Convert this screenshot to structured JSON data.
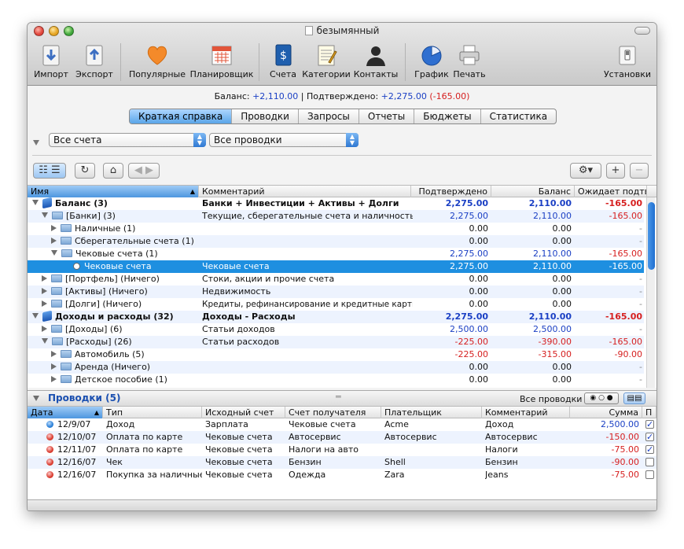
{
  "window": {
    "title": "безымянный"
  },
  "toolbar": {
    "import": "Импорт",
    "export": "Экспорт",
    "popular": "Популярные",
    "planner": "Планировщик",
    "accounts": "Счета",
    "categories": "Категории",
    "contacts": "Контакты",
    "graph": "График",
    "print": "Печать",
    "settings": "Установки"
  },
  "summary": {
    "balance_label": "Баланс:",
    "balance": "+2,110.00",
    "sep": "|",
    "confirmed_label": "Подтверждено:",
    "confirmed": "+2,275.00",
    "diff": "(-165.00)"
  },
  "tabs": [
    "Краткая справка",
    "Проводки",
    "Запросы",
    "Отчеты",
    "Бюджеты",
    "Статистика"
  ],
  "filters": {
    "accounts": "Все счета",
    "transactions": "Все проводки"
  },
  "accounts_table": {
    "headers": {
      "name": "Имя",
      "comment": "Комментарий",
      "confirmed": "Подтверждено",
      "balance": "Баланс",
      "pending": "Ожидает подтв..."
    },
    "rows": [
      {
        "name": "Баланс (3)",
        "comment": "Банки + Инвестиции + Активы + Долги",
        "confirmed": "2,275.00",
        "balance": "2,110.00",
        "pending": "-165.00"
      },
      {
        "name": "[Банки] (3)",
        "comment": "Текущие, сберегательные счета и наличность",
        "confirmed": "2,275.00",
        "balance": "2,110.00",
        "pending": "-165.00"
      },
      {
        "name": "Наличные (1)",
        "comment": "",
        "confirmed": "0.00",
        "balance": "0.00",
        "pending": "-"
      },
      {
        "name": "Сберегательные счета (1)",
        "comment": "",
        "confirmed": "0.00",
        "balance": "0.00",
        "pending": "-"
      },
      {
        "name": "Чековые счета (1)",
        "comment": "",
        "confirmed": "2,275.00",
        "balance": "2,110.00",
        "pending": "-165.00"
      },
      {
        "name": "Чековые счета",
        "comment": "Чековые счета",
        "confirmed": "2,275.00",
        "balance": "2,110.00",
        "pending": "-165.00"
      },
      {
        "name": "[Портфель] (Ничего)",
        "comment": "Стоки, акции и прочие счета",
        "confirmed": "0.00",
        "balance": "0.00",
        "pending": "-"
      },
      {
        "name": "[Активы] (Ничего)",
        "comment": "Недвижимость",
        "confirmed": "0.00",
        "balance": "0.00",
        "pending": "-"
      },
      {
        "name": "[Долги] (Ничего)",
        "comment": "Кредиты, рефинансирование и кредитные карты",
        "confirmed": "0.00",
        "balance": "0.00",
        "pending": "-"
      },
      {
        "name": "Доходы и расходы (32)",
        "comment": "Доходы - Расходы",
        "confirmed": "2,275.00",
        "balance": "2,110.00",
        "pending": "-165.00"
      },
      {
        "name": "[Доходы] (6)",
        "comment": "Статьи доходов",
        "confirmed": "2,500.00",
        "balance": "2,500.00",
        "pending": "-"
      },
      {
        "name": "[Расходы] (26)",
        "comment": "Статьи расходов",
        "confirmed": "-225.00",
        "balance": "-390.00",
        "pending": "-165.00"
      },
      {
        "name": "Автомобиль (5)",
        "comment": "",
        "confirmed": "-225.00",
        "balance": "-315.00",
        "pending": "-90.00"
      },
      {
        "name": "Аренда (Ничего)",
        "comment": "",
        "confirmed": "0.00",
        "balance": "0.00",
        "pending": "-"
      },
      {
        "name": "Детское пособие (1)",
        "comment": "",
        "confirmed": "0.00",
        "balance": "0.00",
        "pending": "-"
      }
    ]
  },
  "transactions": {
    "title": "Проводки (5)",
    "filter_label": "Все проводки",
    "headers": {
      "date": "Дата",
      "type": "Тип",
      "from": "Исходный счет",
      "to": "Счет получателя",
      "payee": "Плательщик",
      "comment": "Комментарий",
      "amount": "Сумма",
      "flag": "П"
    },
    "rows": [
      {
        "date": "12/9/07",
        "type": "Доход",
        "from": "Зарплата",
        "to": "Чековые счета",
        "payee": "Acme",
        "comment": "Доход",
        "amount": "2,500.00",
        "checked": true
      },
      {
        "date": "12/10/07",
        "type": "Оплата по карте",
        "from": "Чековые счета",
        "to": "Автосервис",
        "payee": "Автосервис",
        "comment": "Автосервис",
        "amount": "-150.00",
        "checked": true
      },
      {
        "date": "12/11/07",
        "type": "Оплата по карте",
        "from": "Чековые счета",
        "to": "Налоги на авто",
        "payee": "",
        "comment": "Налоги",
        "amount": "-75.00",
        "checked": true
      },
      {
        "date": "12/16/07",
        "type": "Чек",
        "from": "Чековые счета",
        "to": "Бензин",
        "payee": "Shell",
        "comment": "Бензин",
        "amount": "-90.00",
        "checked": false
      },
      {
        "date": "12/16/07",
        "type": "Покупка за наличные",
        "from": "Чековые счета",
        "to": "Одежда",
        "payee": "Zara",
        "comment": "Jeans",
        "amount": "-75.00",
        "checked": false
      }
    ]
  }
}
